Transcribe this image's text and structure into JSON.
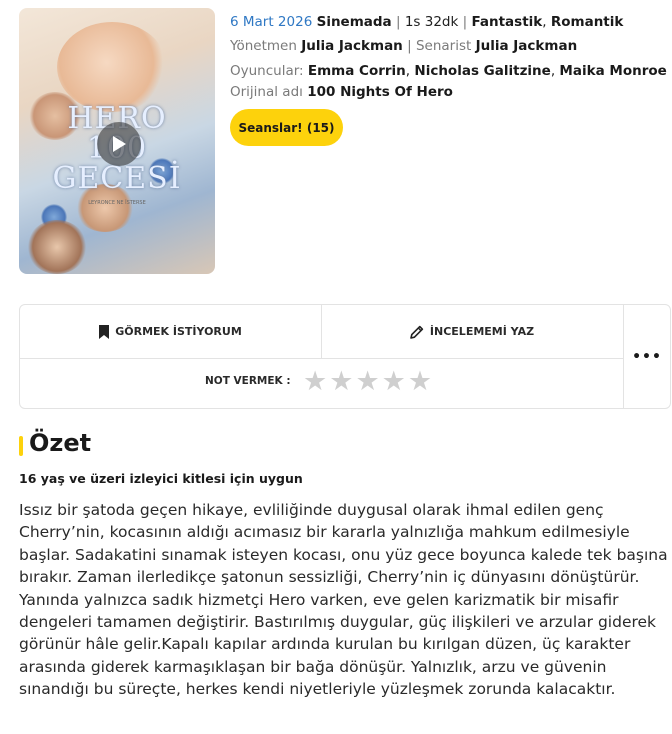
{
  "poster": {
    "title_line1": "HERO",
    "title_line2": "100",
    "title_line3": "GECESİ",
    "subtitle": "LEYRONCE NE İSTERSE"
  },
  "meta": {
    "date": "6 Mart 2026",
    "venue": "Sinemada",
    "sep1": " | ",
    "duration": "1s 32dk",
    "sep2": " | ",
    "genre1": "Fantastik",
    "genre_sep": ", ",
    "genre2": "Romantik",
    "director_label": "Yönetmen",
    "director": "Julia Jackman",
    "sep3": " | ",
    "writer_label": "Senarist",
    "writer": "Julia Jackman",
    "cast_label": "Oyuncular:",
    "cast1": "Emma Corrin",
    "cast_sep1": ", ",
    "cast2": "Nicholas Galitzine",
    "cast_sep2": ", ",
    "cast3": "Maika Monroe",
    "original_label": "Orijinal adı",
    "original_title": "100 Nights Of Hero"
  },
  "seans_button": "Seanslar! (15)",
  "actions": {
    "watchlist": "GÖRMEK İSTİYORUM",
    "review": "İNCELEMEMİ YAZ",
    "more": "•••",
    "rate_label": "NOT VERMEK :",
    "stars": [
      "★",
      "★",
      "★",
      "★",
      "★"
    ]
  },
  "summary": {
    "heading": "Özet",
    "age_notice": "16 yaş ve üzeri izleyici kitlesi için uygun",
    "text": "Issız bir şatoda geçen hikaye, evliliğinde duygusal olarak ihmal edilen genç Cherry’nin, kocasının aldığı acımasız bir kararla yalnızlığa mahkum edilmesiyle başlar. Sadakatini sınamak isteyen kocası, onu yüz gece boyunca kalede tek başına bırakır. Zaman ilerledikçe şatonun sessizliği, Cherry’nin iç dünyasını dönüştürür. Yanında yalnızca sadık hizmetçi Hero varken, eve gelen karizmatik bir misafir dengeleri tamamen değiştirir. Bastırılmış duygular, güç ilişkileri ve arzular giderek görünür hâle gelir.Kapalı kapılar ardında kurulan bu kırılgan düzen, üç karakter arasında giderek karmaşıklaşan bir bağa dönüşür. Yalnızlık, arzu ve güvenin sınandığı bu süreçte, herkes kendi niyetleriyle yüzleşmek zorunda kalacaktır."
  },
  "colors": {
    "accent_yellow": "#fdd20c",
    "link_blue": "#2f78c4",
    "star_empty": "#cfcfcf"
  },
  "icons": {
    "play": "play-icon",
    "bookmark": "bookmark-icon",
    "pencil": "pencil-icon",
    "more": "more-dots-icon",
    "star": "star-icon"
  }
}
